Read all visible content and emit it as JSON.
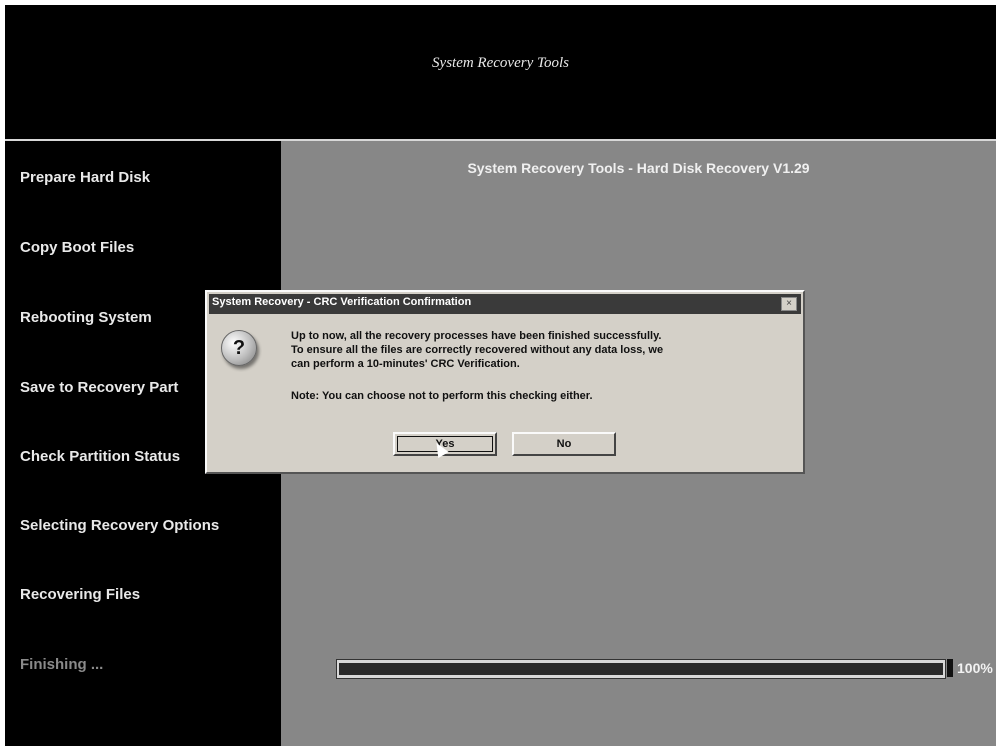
{
  "banner": {
    "title": "System Recovery Tools"
  },
  "sidebar": {
    "steps": [
      {
        "label": "Prepare Hard Disk"
      },
      {
        "label": "Copy Boot Files"
      },
      {
        "label": "Rebooting System"
      },
      {
        "label": "Save to Recovery Part"
      },
      {
        "label": "Check Partition Status"
      },
      {
        "label": "Selecting Recovery Options"
      },
      {
        "label": "Recovering Files"
      },
      {
        "label": "Finishing ..."
      }
    ]
  },
  "main": {
    "title": "System Recovery Tools - Hard Disk Recovery V1.29",
    "progress": {
      "value": 1.0,
      "label": "100%"
    }
  },
  "dialog": {
    "title": "System Recovery - CRC Verification Confirmation",
    "close_glyph": "×",
    "icon": "question-icon",
    "icon_glyph": "?",
    "message_lines": [
      "Up to now, all the recovery processes have been finished successfully.",
      "To ensure all the files are correctly recovered without any data loss, we",
      "can perform a 10-minutes' CRC Verification."
    ],
    "note": "Note: You can choose not to perform this checking either.",
    "buttons": {
      "yes": "Yes",
      "no": "No"
    }
  }
}
